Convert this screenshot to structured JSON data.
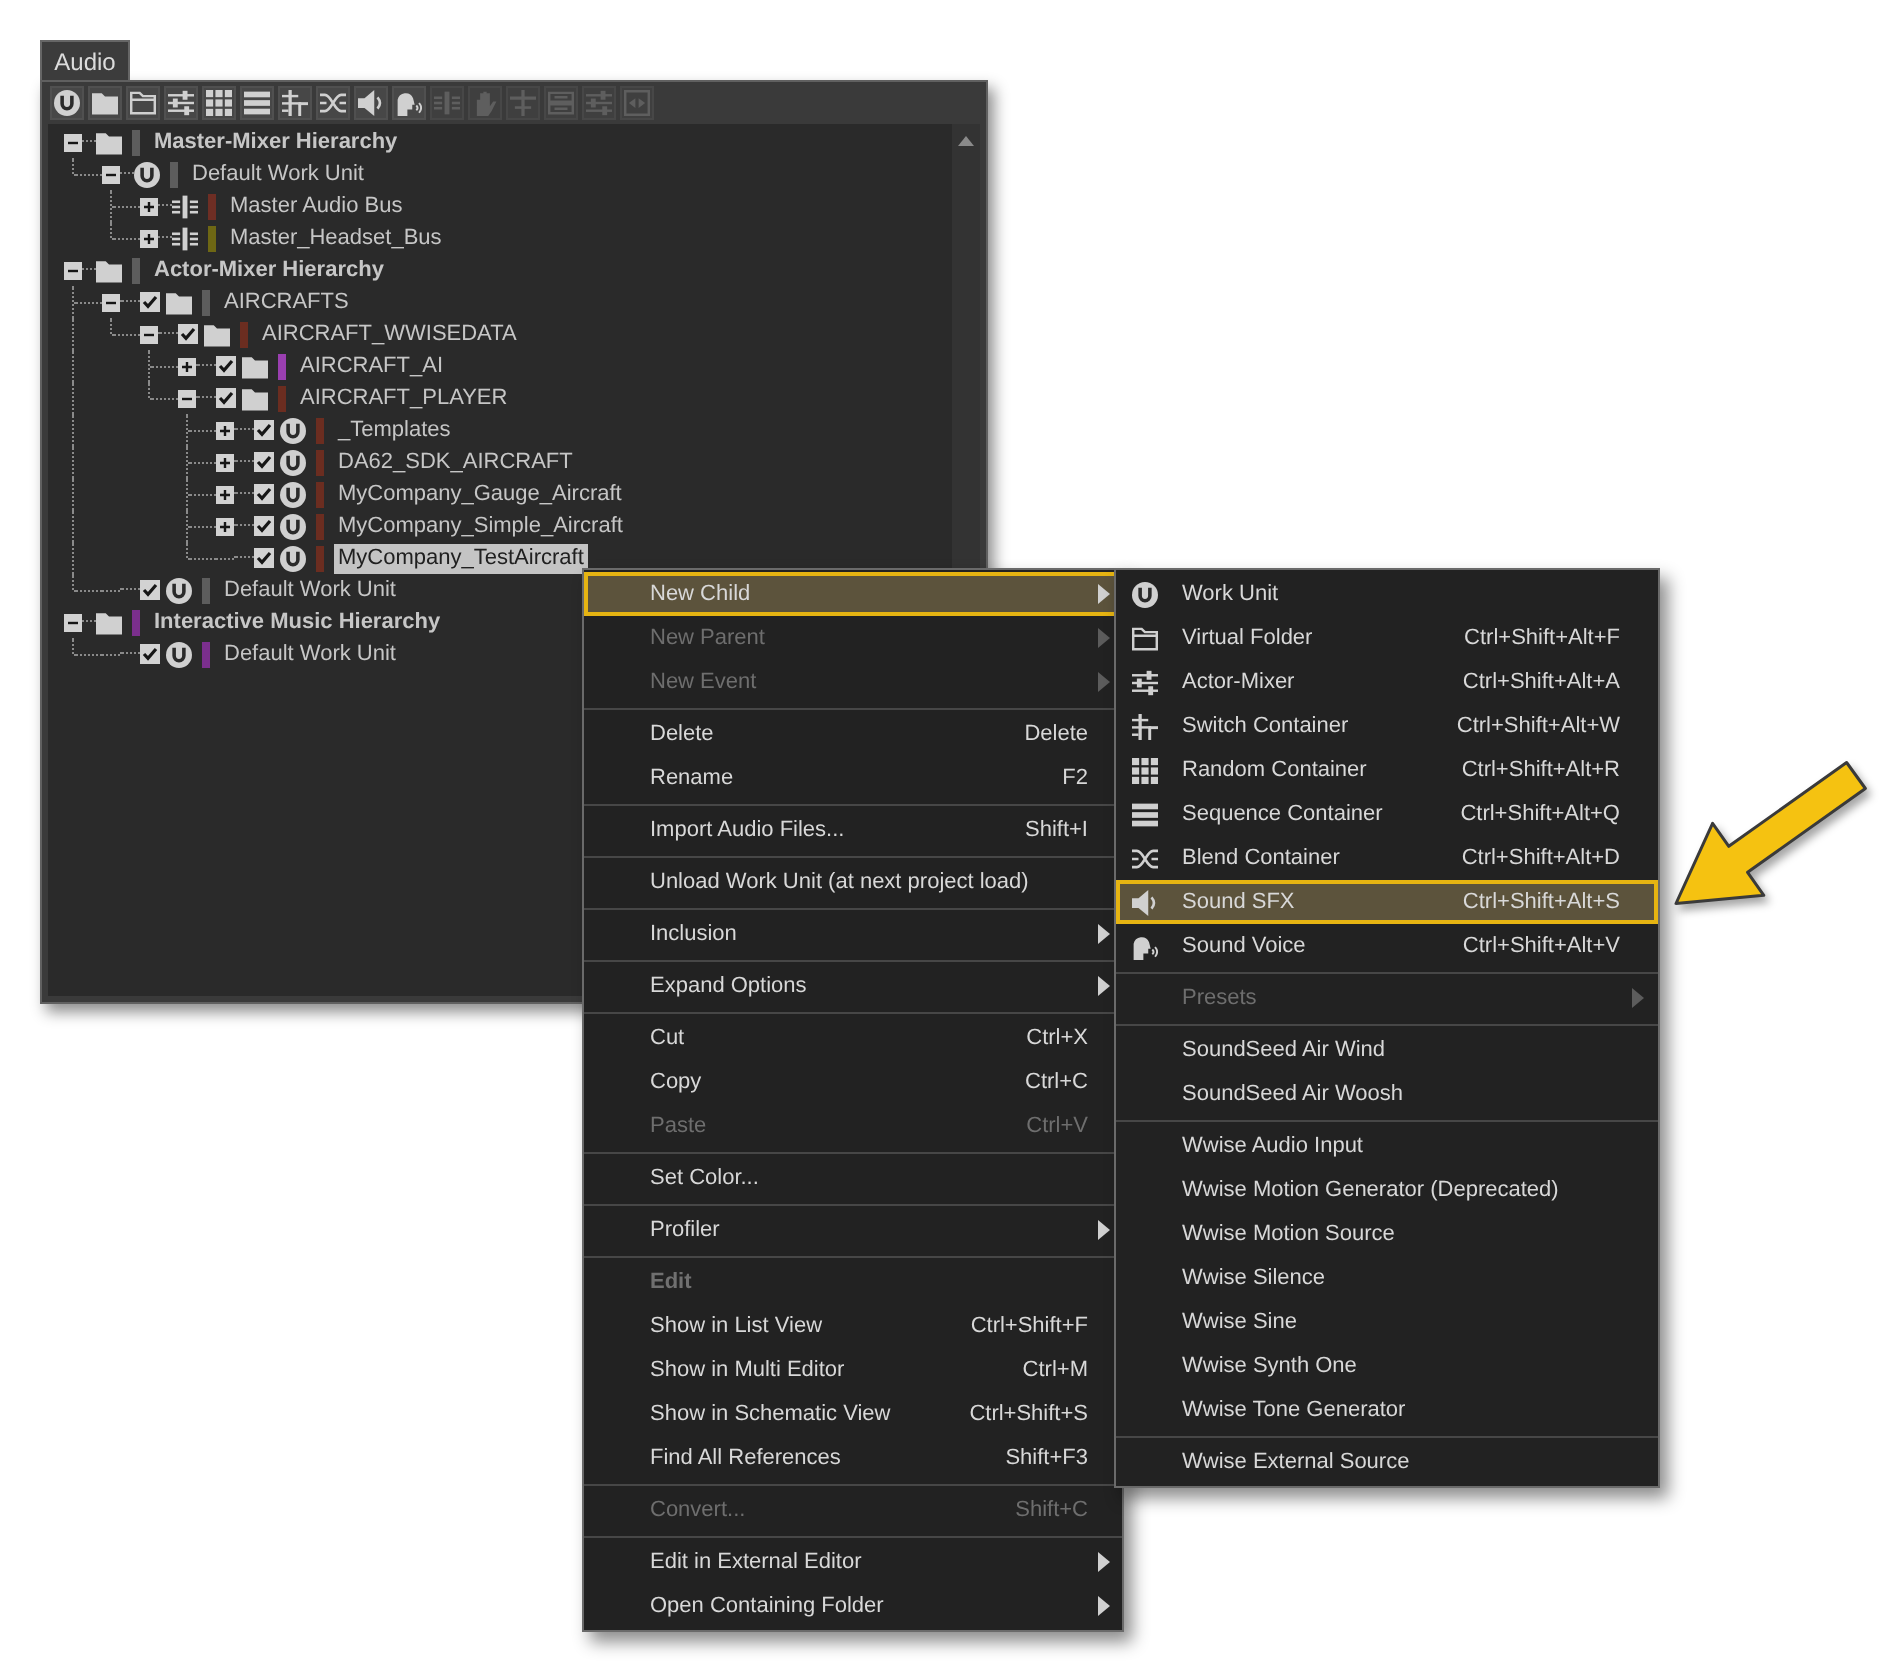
{
  "panel": {
    "tab": "Audio",
    "toolbar": [
      {
        "kind": "work-unit",
        "disabled": false
      },
      {
        "kind": "folder",
        "disabled": false
      },
      {
        "kind": "virtual-folder",
        "disabled": false
      },
      {
        "kind": "actor-mixer",
        "disabled": false
      },
      {
        "kind": "random",
        "disabled": false
      },
      {
        "kind": "sequence",
        "disabled": false
      },
      {
        "kind": "switch",
        "disabled": false
      },
      {
        "kind": "blend",
        "disabled": false
      },
      {
        "kind": "sound-sfx",
        "disabled": false
      },
      {
        "kind": "sound-voice",
        "disabled": false
      },
      {
        "kind": "bus",
        "disabled": true
      },
      {
        "kind": "hand",
        "disabled": true
      },
      {
        "kind": "crossbar",
        "disabled": true
      },
      {
        "kind": "double-bar",
        "disabled": true
      },
      {
        "kind": "actor-mixer",
        "disabled": true
      },
      {
        "kind": "boxed-arrows",
        "disabled": true
      }
    ]
  },
  "tree": [
    {
      "label": "Master-Mixer Hierarchy",
      "kind": "folder",
      "color": "#5d5d5d",
      "expanded": true,
      "selected": false,
      "children": [
        {
          "label": "Default Work Unit",
          "kind": "work-unit",
          "color": "#5d5d5d",
          "expanded": true,
          "selected": false,
          "children": [
            {
              "label": "Master Audio Bus",
              "kind": "bus",
              "color": "#6e2e24",
              "expanded": false,
              "selected": false
            },
            {
              "label": "Master_Headset_Bus",
              "kind": "bus",
              "color": "#6e6714",
              "expanded": false,
              "selected": false
            }
          ]
        }
      ]
    },
    {
      "label": "Actor-Mixer Hierarchy",
      "kind": "folder",
      "color": "#5d5d5d",
      "expanded": true,
      "selected": false,
      "children": [
        {
          "label": "AIRCRAFTS",
          "kind": "folder",
          "color": "#5d5d5d",
          "checked": true,
          "expanded": true,
          "selected": false,
          "children": [
            {
              "label": "AIRCRAFT_WWISEDATA",
              "kind": "folder",
              "color": "#6b2d20",
              "checked": true,
              "expanded": true,
              "selected": false,
              "children": [
                {
                  "label": "AIRCRAFT_AI",
                  "kind": "folder",
                  "color": "#9a3fb0",
                  "checked": true,
                  "expanded": false,
                  "selected": false
                },
                {
                  "label": "AIRCRAFT_PLAYER",
                  "kind": "folder",
                  "color": "#6b2d20",
                  "checked": true,
                  "expanded": true,
                  "selected": false,
                  "children": [
                    {
                      "label": "_Templates",
                      "kind": "work-unit",
                      "color": "#6b2d20",
                      "checked": true,
                      "expanded": false,
                      "selected": false
                    },
                    {
                      "label": "DA62_SDK_AIRCRAFT",
                      "kind": "work-unit",
                      "color": "#6b2d20",
                      "checked": true,
                      "expanded": false,
                      "selected": false
                    },
                    {
                      "label": "MyCompany_Gauge_Aircraft",
                      "kind": "work-unit",
                      "color": "#6b2d20",
                      "checked": true,
                      "expanded": false,
                      "selected": false
                    },
                    {
                      "label": "MyCompany_Simple_Aircraft",
                      "kind": "work-unit",
                      "color": "#6b2d20",
                      "checked": true,
                      "expanded": false,
                      "selected": false
                    },
                    {
                      "label": "MyCompany_TestAircraft",
                      "kind": "work-unit",
                      "color": "#6b2d20",
                      "checked": true,
                      "selected": true
                    }
                  ]
                }
              ]
            }
          ]
        },
        {
          "label": "Default Work Unit",
          "kind": "work-unit",
          "color": "#5d5d5d",
          "checked": true,
          "selected": false
        }
      ]
    },
    {
      "label": "Interactive Music Hierarchy",
      "kind": "folder",
      "color": "#7b2f8d",
      "expanded": true,
      "selected": false,
      "children": [
        {
          "label": "Default Work Unit",
          "kind": "work-unit",
          "color": "#7b2f8d",
          "checked": true,
          "selected": false
        }
      ]
    }
  ],
  "context_menu": {
    "groups": [
      {
        "items": [
          {
            "kind": "command",
            "label": "New Child",
            "submenu": true,
            "disabled": false,
            "selected": true
          },
          {
            "kind": "command",
            "label": "New Parent",
            "submenu": true,
            "disabled": true,
            "selected": false
          },
          {
            "kind": "command",
            "label": "New Event",
            "submenu": true,
            "disabled": true,
            "selected": false
          }
        ]
      },
      {
        "items": [
          {
            "kind": "command",
            "label": "Delete",
            "shortcut": "Delete",
            "submenu": false,
            "disabled": false,
            "selected": false
          },
          {
            "kind": "command",
            "label": "Rename",
            "shortcut": "F2",
            "submenu": false,
            "disabled": false,
            "selected": false
          }
        ]
      },
      {
        "items": [
          {
            "kind": "command",
            "label": "Import Audio Files...",
            "shortcut": "Shift+I",
            "submenu": false,
            "disabled": false,
            "selected": false
          }
        ]
      },
      {
        "items": [
          {
            "kind": "command",
            "label": "Unload Work Unit (at next project load)",
            "submenu": false,
            "disabled": false,
            "selected": false
          }
        ]
      },
      {
        "items": [
          {
            "kind": "command",
            "label": "Inclusion",
            "submenu": true,
            "disabled": false,
            "selected": false
          }
        ]
      },
      {
        "items": [
          {
            "kind": "command",
            "label": "Expand Options",
            "submenu": true,
            "disabled": false,
            "selected": false
          }
        ]
      },
      {
        "items": [
          {
            "kind": "command",
            "label": "Cut",
            "shortcut": "Ctrl+X",
            "submenu": false,
            "disabled": false,
            "selected": false
          },
          {
            "kind": "command",
            "label": "Copy",
            "shortcut": "Ctrl+C",
            "submenu": false,
            "disabled": false,
            "selected": false
          },
          {
            "kind": "command",
            "label": "Paste",
            "shortcut": "Ctrl+V",
            "submenu": false,
            "disabled": true,
            "selected": false
          }
        ]
      },
      {
        "items": [
          {
            "kind": "command",
            "label": "Set Color...",
            "submenu": false,
            "disabled": false,
            "selected": false
          }
        ]
      },
      {
        "items": [
          {
            "kind": "command",
            "label": "Profiler",
            "submenu": true,
            "disabled": false,
            "selected": false
          }
        ]
      },
      {
        "items": [
          {
            "kind": "header",
            "label": "Edit",
            "disabled": true
          },
          {
            "kind": "command",
            "label": "Show in List View",
            "shortcut": "Ctrl+Shift+F",
            "submenu": false,
            "disabled": false,
            "selected": false
          },
          {
            "kind": "command",
            "label": "Show in Multi Editor",
            "shortcut": "Ctrl+M",
            "submenu": false,
            "disabled": false,
            "selected": false
          },
          {
            "kind": "command",
            "label": "Show in Schematic View",
            "shortcut": "Ctrl+Shift+S",
            "submenu": false,
            "disabled": false,
            "selected": false
          },
          {
            "kind": "command",
            "label": "Find All References",
            "shortcut": "Shift+F3",
            "submenu": false,
            "disabled": false,
            "selected": false
          }
        ]
      },
      {
        "items": [
          {
            "kind": "command",
            "label": "Convert...",
            "shortcut": "Shift+C",
            "submenu": false,
            "disabled": true,
            "selected": false
          }
        ]
      },
      {
        "items": [
          {
            "kind": "command",
            "label": "Edit in External Editor",
            "submenu": true,
            "disabled": false,
            "selected": false
          },
          {
            "kind": "command",
            "label": "Open Containing Folder",
            "submenu": true,
            "disabled": false,
            "selected": false
          }
        ]
      }
    ]
  },
  "submenu": {
    "groups": [
      {
        "items": [
          {
            "kind": "work-unit",
            "label": "Work Unit",
            "submenu": false,
            "disabled": false,
            "selected": false
          },
          {
            "kind": "virtual-folder",
            "label": "Virtual Folder",
            "shortcut": "Ctrl+Shift+Alt+F",
            "submenu": false,
            "disabled": false,
            "selected": false
          },
          {
            "kind": "actor-mixer",
            "label": "Actor-Mixer",
            "shortcut": "Ctrl+Shift+Alt+A",
            "submenu": false,
            "disabled": false,
            "selected": false
          },
          {
            "kind": "switch",
            "label": "Switch Container",
            "shortcut": "Ctrl+Shift+Alt+W",
            "submenu": false,
            "disabled": false,
            "selected": false
          },
          {
            "kind": "random",
            "label": "Random Container",
            "shortcut": "Ctrl+Shift+Alt+R",
            "submenu": false,
            "disabled": false,
            "selected": false
          },
          {
            "kind": "sequence",
            "label": "Sequence Container",
            "shortcut": "Ctrl+Shift+Alt+Q",
            "submenu": false,
            "disabled": false,
            "selected": false
          },
          {
            "kind": "blend",
            "label": "Blend Container",
            "shortcut": "Ctrl+Shift+Alt+D",
            "submenu": false,
            "disabled": false,
            "selected": false
          },
          {
            "kind": "sound-sfx",
            "label": "Sound SFX",
            "shortcut": "Ctrl+Shift+Alt+S",
            "submenu": false,
            "disabled": false,
            "selected": true
          },
          {
            "kind": "sound-voice",
            "label": "Sound Voice",
            "shortcut": "Ctrl+Shift+Alt+V",
            "submenu": false,
            "disabled": false,
            "selected": false
          }
        ]
      },
      {
        "items": [
          {
            "kind": "plain",
            "label": "Presets",
            "submenu": true,
            "disabled": true,
            "selected": false
          }
        ]
      },
      {
        "items": [
          {
            "kind": "plain",
            "label": "SoundSeed Air Wind",
            "submenu": false,
            "disabled": false,
            "selected": false
          },
          {
            "kind": "plain",
            "label": "SoundSeed Air Woosh",
            "submenu": false,
            "disabled": false,
            "selected": false
          }
        ]
      },
      {
        "items": [
          {
            "kind": "plain",
            "label": "Wwise Audio Input",
            "submenu": false,
            "disabled": false,
            "selected": false
          },
          {
            "kind": "plain",
            "label": "Wwise Motion Generator (Deprecated)",
            "submenu": false,
            "disabled": false,
            "selected": false
          },
          {
            "kind": "plain",
            "label": "Wwise Motion Source",
            "submenu": false,
            "disabled": false,
            "selected": false
          },
          {
            "kind": "plain",
            "label": "Wwise Silence",
            "submenu": false,
            "disabled": false,
            "selected": false
          },
          {
            "kind": "plain",
            "label": "Wwise Sine",
            "submenu": false,
            "disabled": false,
            "selected": false
          },
          {
            "kind": "plain",
            "label": "Wwise Synth One",
            "submenu": false,
            "disabled": false,
            "selected": false
          },
          {
            "kind": "plain",
            "label": "Wwise Tone Generator",
            "submenu": false,
            "disabled": false,
            "selected": false
          }
        ]
      },
      {
        "items": [
          {
            "kind": "plain",
            "label": "Wwise External Source",
            "submenu": false,
            "disabled": false,
            "selected": false
          }
        ]
      }
    ]
  }
}
